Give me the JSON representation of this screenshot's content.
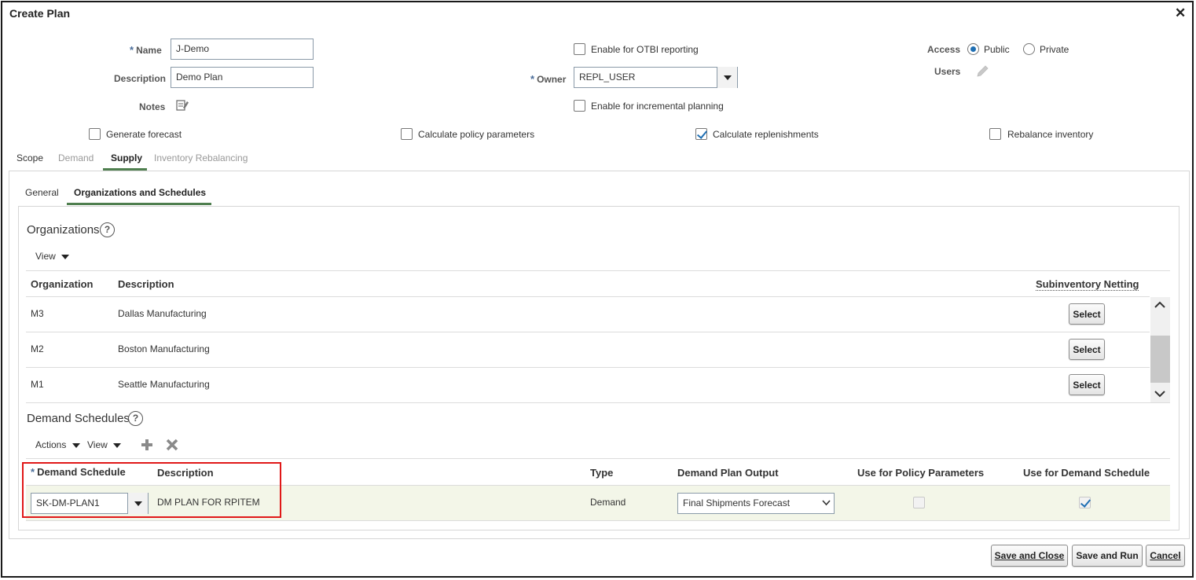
{
  "dialog": {
    "title": "Create Plan",
    "close_glyph": "✕"
  },
  "form": {
    "name_label": "Name",
    "name_value": "J-Demo",
    "description_label": "Description",
    "description_value": "Demo Plan",
    "notes_label": "Notes",
    "notes_icon": "notes-icon",
    "enable_otbi_label": "Enable for OTBI reporting",
    "owner_label": "Owner",
    "owner_value": "REPL_USER",
    "enable_incremental_label": "Enable for incremental planning",
    "access_label": "Access",
    "access_public_label": "Public",
    "access_private_label": "Private",
    "access_selected": "Public",
    "users_label": "Users",
    "required_mark": "*"
  },
  "options": {
    "generate_forecast": {
      "label": "Generate forecast",
      "checked": false
    },
    "calculate_policy": {
      "label": "Calculate policy parameters",
      "checked": false
    },
    "calculate_replenishments": {
      "label": "Calculate replenishments",
      "checked": true
    },
    "rebalance_inventory": {
      "label": "Rebalance inventory",
      "checked": false
    }
  },
  "tabs": [
    {
      "label": "Scope",
      "state": "normal"
    },
    {
      "label": "Demand",
      "state": "disabled"
    },
    {
      "label": "Supply",
      "state": "selected"
    },
    {
      "label": "Inventory Rebalancing",
      "state": "disabled"
    }
  ],
  "subtabs": [
    {
      "label": "General",
      "state": "normal"
    },
    {
      "label": "Organizations and Schedules",
      "state": "selected"
    }
  ],
  "organizations": {
    "title": "Organizations",
    "view_label": "View",
    "columns": [
      "Organization",
      "Description",
      "Subinventory Netting"
    ],
    "rows": [
      {
        "org": "M3",
        "desc": "Dallas Manufacturing",
        "action": "Select"
      },
      {
        "org": "M2",
        "desc": "Boston Manufacturing",
        "action": "Select"
      },
      {
        "org": "M1",
        "desc": "Seattle Manufacturing",
        "action": "Select"
      }
    ]
  },
  "demand_schedules": {
    "title": "Demand Schedules",
    "actions_label": "Actions",
    "view_label": "View",
    "columns": [
      "Demand Schedule",
      "Description",
      "Type",
      "Demand Plan Output",
      "Use for Policy Parameters",
      "Use for Demand Schedule"
    ],
    "rows": [
      {
        "schedule": "SK-DM-PLAN1",
        "description": "DM PLAN FOR RPITEM",
        "type": "Demand",
        "output": "Final Shipments Forecast",
        "use_policy": false,
        "use_demand": true
      }
    ]
  },
  "footer": {
    "save_close_label": "Save and Close",
    "save_run_label": "Save and Run",
    "cancel_label": "Cancel"
  },
  "colors": {
    "accent": "#1f6fb3",
    "tab_underline": "#4f7f4f",
    "highlight_box": "#e01818",
    "selected_row_bg": "#f3f6e8"
  }
}
